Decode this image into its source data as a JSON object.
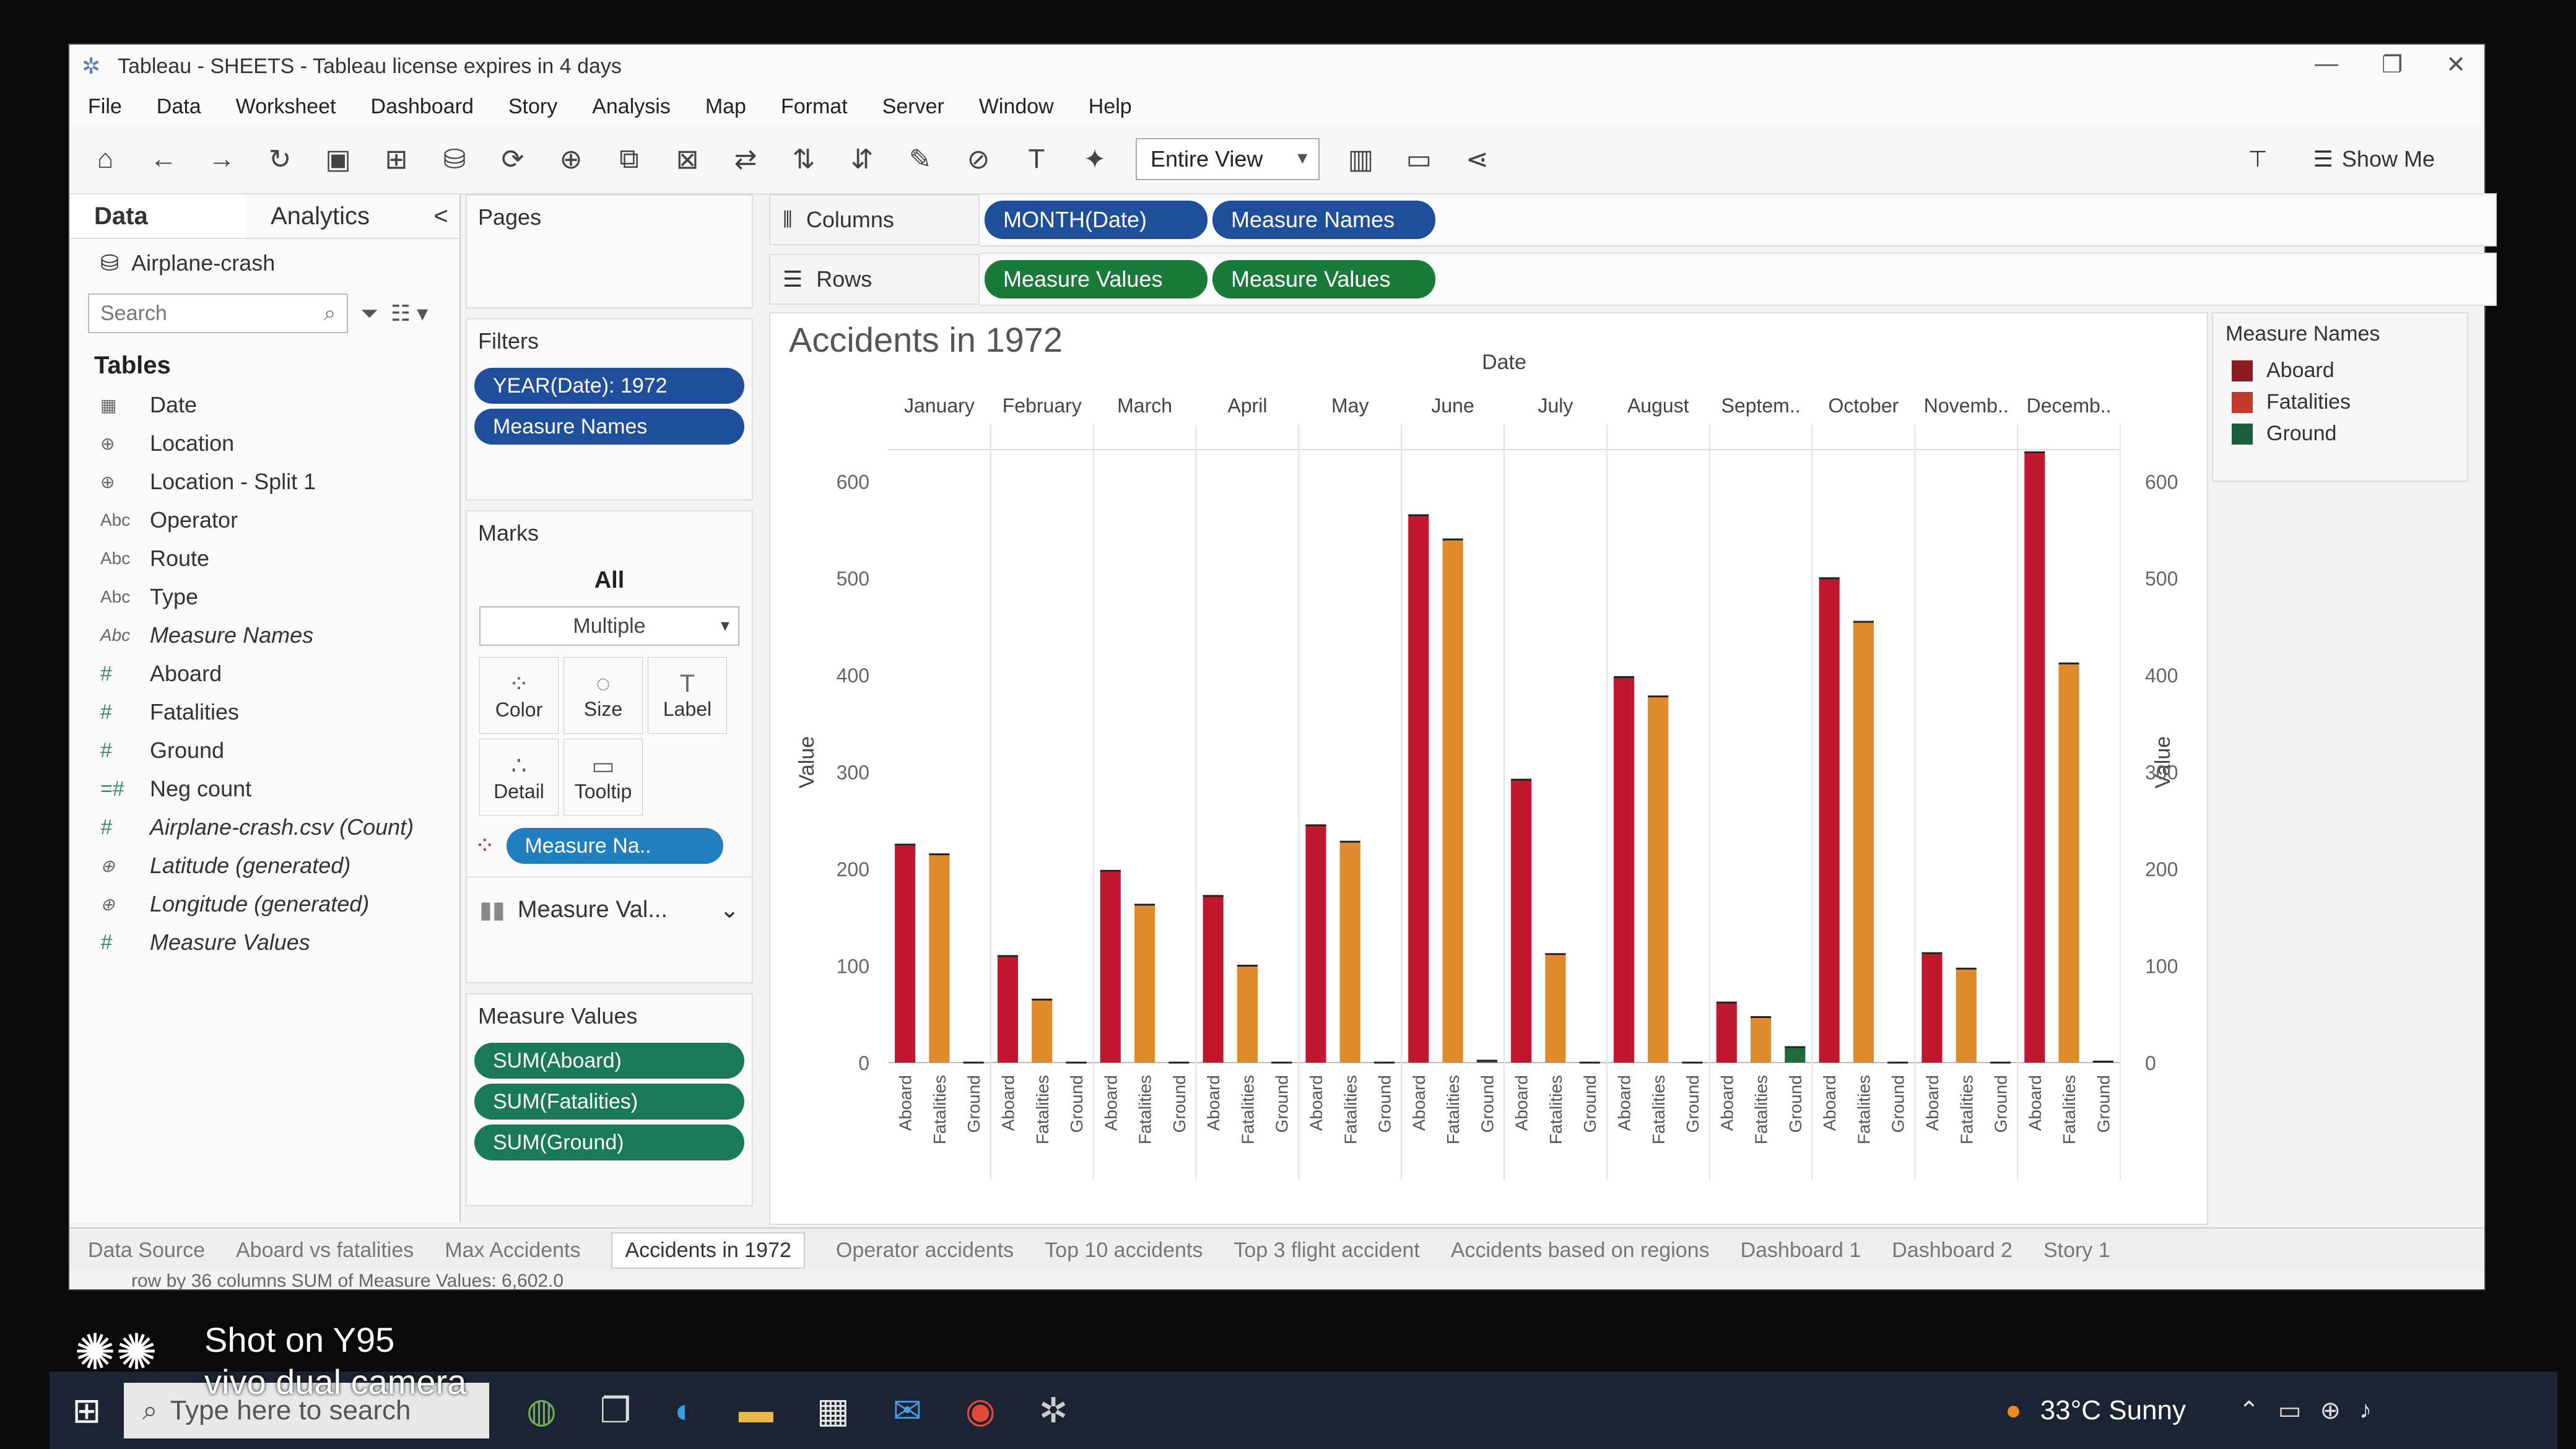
{
  "window": {
    "title": "Tableau - SHEETS - Tableau license expires in 4 days"
  },
  "menu": [
    "File",
    "Data",
    "Worksheet",
    "Dashboard",
    "Story",
    "Analysis",
    "Map",
    "Format",
    "Server",
    "Window",
    "Help"
  ],
  "toolbar": {
    "fit": "Entire View",
    "show_me": "Show Me"
  },
  "datapane": {
    "tab_data": "Data",
    "tab_analytics": "Analytics",
    "collapse": "<",
    "datasource": "Airplane-crash",
    "search_placeholder": "Search",
    "tables_heading": "Tables",
    "fields": [
      {
        "icon": "calendar-icon",
        "glyph": "▦",
        "name": "Date",
        "italic": false
      },
      {
        "icon": "globe-icon",
        "glyph": "⊕",
        "name": "Location",
        "italic": false
      },
      {
        "icon": "globe-icon",
        "glyph": "⊕",
        "name": "Location - Split 1",
        "italic": false
      },
      {
        "icon": "abc-icon",
        "glyph": "Abc",
        "name": "Operator",
        "italic": false
      },
      {
        "icon": "abc-icon",
        "glyph": "Abc",
        "name": "Route",
        "italic": false
      },
      {
        "icon": "abc-icon",
        "glyph": "Abc",
        "name": "Type",
        "italic": false
      },
      {
        "icon": "abc-icon",
        "glyph": "Abc",
        "name": "Measure Names",
        "italic": true
      },
      {
        "icon": "number-icon",
        "glyph": "#",
        "name": "Aboard",
        "italic": false
      },
      {
        "icon": "number-icon",
        "glyph": "#",
        "name": "Fatalities",
        "italic": false
      },
      {
        "icon": "number-icon",
        "glyph": "#",
        "name": "Ground",
        "italic": false
      },
      {
        "icon": "number-icon",
        "glyph": "=#",
        "name": "Neg count",
        "italic": false
      },
      {
        "icon": "number-icon",
        "glyph": "#",
        "name": "Airplane-crash.csv (Count)",
        "italic": true
      },
      {
        "icon": "globe-icon",
        "glyph": "⊕",
        "name": "Latitude (generated)",
        "italic": true
      },
      {
        "icon": "globe-icon",
        "glyph": "⊕",
        "name": "Longitude (generated)",
        "italic": true
      },
      {
        "icon": "number-icon",
        "glyph": "#",
        "name": "Measure Values",
        "italic": true
      }
    ]
  },
  "pages": {
    "title": "Pages"
  },
  "filters": {
    "title": "Filters",
    "items": [
      "YEAR(Date): 1972",
      "Measure Names"
    ]
  },
  "marks": {
    "title": "Marks",
    "all": "All",
    "type": "Multiple",
    "buttons": [
      {
        "label": "Color",
        "glyph": "⁘"
      },
      {
        "label": "Size",
        "glyph": "◌"
      },
      {
        "label": "Label",
        "glyph": "T"
      },
      {
        "label": "Detail",
        "glyph": "∴"
      },
      {
        "label": "Tooltip",
        "glyph": "▭"
      }
    ],
    "color_pill": "Measure Na..",
    "measure_val": "Measure Val..."
  },
  "measure_values_card": {
    "title": "Measure Values",
    "items": [
      "SUM(Aboard)",
      "SUM(Fatalities)",
      "SUM(Ground)"
    ]
  },
  "shelves": {
    "columns_label": "Columns",
    "columns": [
      "MONTH(Date)",
      "Measure Names"
    ],
    "rows_label": "Rows",
    "rows": [
      "Measure Values",
      "Measure Values"
    ]
  },
  "legend": {
    "title": "Measure Names",
    "items": [
      {
        "name": "Aboard",
        "color": "#8b1a22"
      },
      {
        "name": "Fatalities",
        "color": "#c0392b"
      },
      {
        "name": "Ground",
        "color": "#1b5e3a"
      }
    ]
  },
  "chart_data": {
    "type": "bar",
    "title": "Accidents in 1972",
    "header_label": "Date",
    "ylabel": "Value",
    "ylim": [
      0,
      620
    ],
    "yticks": [
      0,
      100,
      200,
      300,
      400,
      500,
      600
    ],
    "categories": [
      "January",
      "February",
      "March",
      "April",
      "May",
      "June",
      "July",
      "August",
      "Septem..",
      "October",
      "Novemb..",
      "Decemb.."
    ],
    "measures": [
      "Aboard",
      "Fatalities",
      "Ground"
    ],
    "series": [
      {
        "name": "Aboard",
        "color": "#c0182f",
        "values": [
          225,
          110,
          198,
          172,
          245,
          565,
          292,
          398,
          62,
          500,
          113,
          630
        ]
      },
      {
        "name": "Fatalities",
        "color": "#e08a2e",
        "values": [
          215,
          65,
          163,
          100,
          228,
          540,
          112,
          378,
          47,
          455,
          97,
          412
        ]
      },
      {
        "name": "Ground",
        "color": "#1f6b3a",
        "values": [
          0,
          0,
          0,
          0,
          0,
          2,
          0,
          0,
          16,
          0,
          0,
          1
        ]
      }
    ]
  },
  "sheet_tabs": [
    "Data Source",
    "Aboard vs fatalities",
    "Max Accidents",
    "Accidents in 1972",
    "Operator accidents",
    "Top 10 accidents",
    "Top 3 flight accident",
    "Accidents based on regions",
    "Dashboard 1",
    "Dashboard 2",
    "Story 1"
  ],
  "active_tab": "Accidents in 1972",
  "status": {
    "text": "row by 36 columns   SUM of Measure Values: 6,602.0"
  },
  "taskbar": {
    "search": "Type here to search",
    "weather": "33°C  Sunny"
  },
  "watermark": {
    "line1": "Shot on Y95",
    "line2": "vivo dual camera"
  }
}
